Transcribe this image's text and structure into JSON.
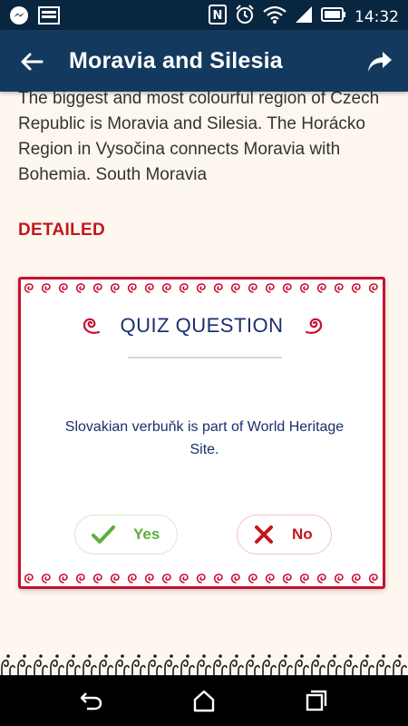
{
  "status_bar": {
    "time": "14:32",
    "icons": [
      "messenger-icon",
      "image-icon",
      "nfc-icon",
      "alarm-icon",
      "wifi-icon",
      "signal-icon",
      "battery-icon"
    ]
  },
  "app_bar": {
    "title": "Moravia and Silesia",
    "back_icon": "arrow-back-icon",
    "share_icon": "share-icon"
  },
  "content": {
    "body_text": "The biggest and most colourful region of Czech Republic is Moravia and Silesia. The Horácko Region in Vysočina connects Moravia with Bohemia. South Moravia",
    "detailed_label": "DETAILED"
  },
  "quiz": {
    "title": "QUIZ QUESTION",
    "question": "Slovakian verbuňk is part of World Heritage Site.",
    "yes_label": "Yes",
    "no_label": "No"
  },
  "nav_bar": {
    "icons": [
      "back-icon",
      "home-icon",
      "recents-icon"
    ]
  },
  "colors": {
    "app_bar": "#133a5e",
    "status_bar": "#08263f",
    "accent_red": "#c8102e",
    "quiz_navy": "#1b2f6e",
    "yes_green": "#5ab03f",
    "background": "#fdf7ef"
  }
}
